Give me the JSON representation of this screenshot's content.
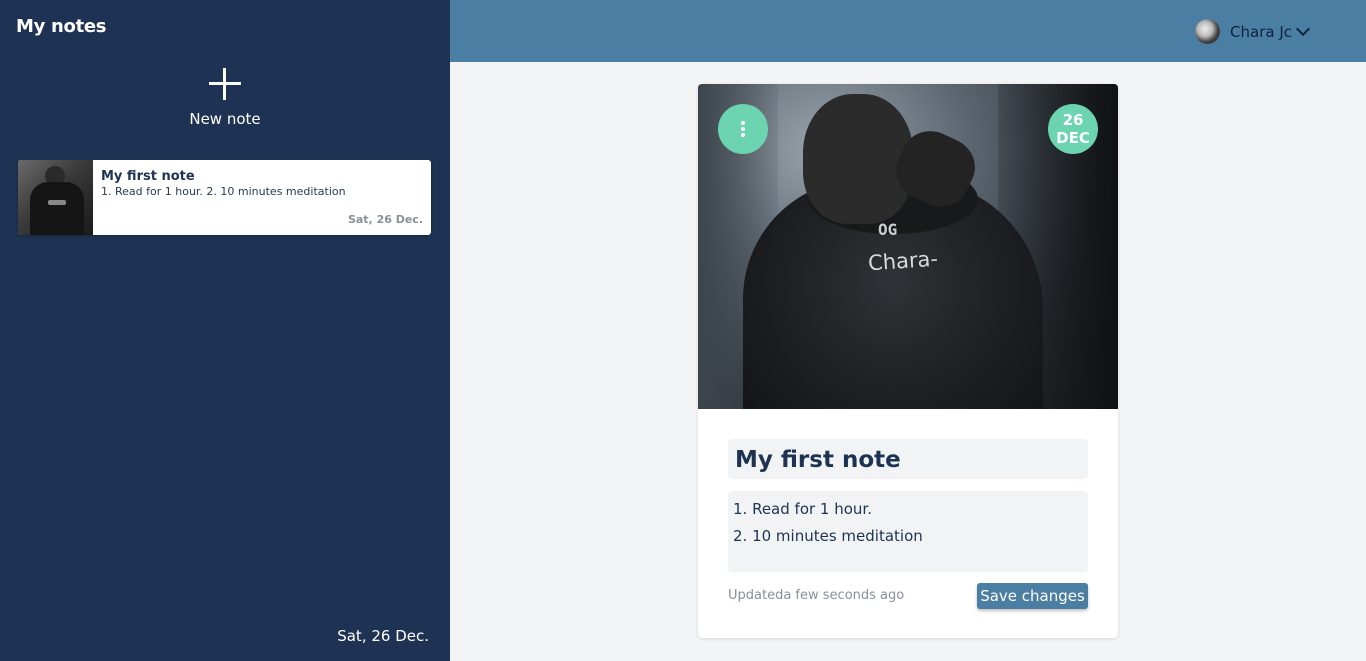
{
  "sidebar": {
    "title": "My notes",
    "new_note_label": "New note",
    "notes": [
      {
        "title": "My first note",
        "preview": "1. Read for 1 hour. 2. 10 minutes meditation",
        "date": "Sat, 26 Dec."
      }
    ],
    "footer_date": "Sat, 26 Dec."
  },
  "header": {
    "user_name": "Chara Jc"
  },
  "card": {
    "image_text": "Chara-",
    "badge_day": "26",
    "badge_month": "DEC",
    "title": "My first note",
    "body_lines": [
      "1. Read for 1 hour.",
      "2. 10 minutes meditation"
    ],
    "updated": "Updateda few seconds ago",
    "save_label": "Save changes"
  },
  "colors": {
    "sidebar_bg": "#1e3354",
    "header_bg": "#4a7ea3",
    "accent": "#6cd4b0",
    "button": "#4a7ea3"
  },
  "icons": [
    "plus-icon",
    "chevron-down-icon",
    "more-vertical-icon"
  ]
}
